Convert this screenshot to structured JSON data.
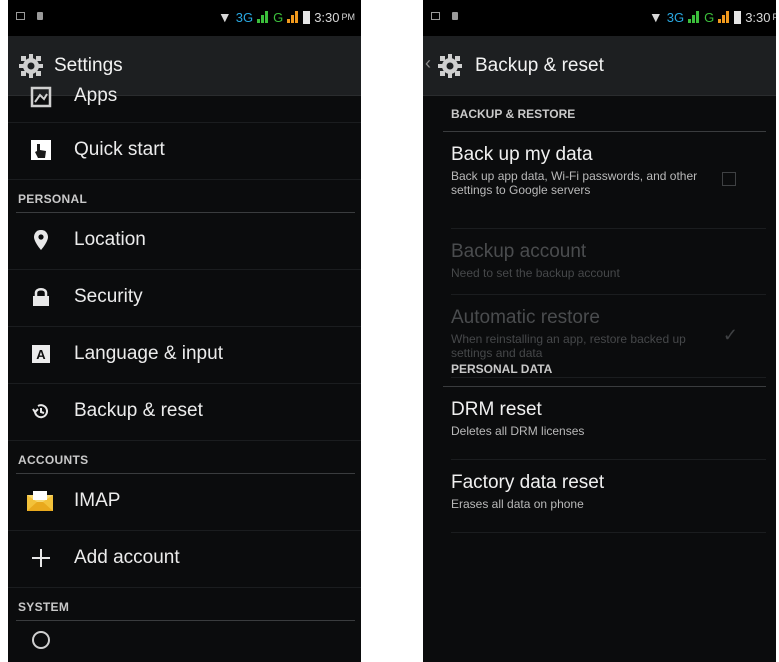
{
  "status_bar": {
    "net_3g": "3G",
    "net_g": "G",
    "time": "3:30",
    "ampm": "PM"
  },
  "left": {
    "title": "Settings",
    "items": [
      {
        "type": "item",
        "label": "Apps",
        "icon": "apps-icon"
      },
      {
        "type": "item",
        "label": "Quick start",
        "icon": "quick-start-icon"
      },
      {
        "type": "header",
        "label": "PERSONAL"
      },
      {
        "type": "item",
        "label": "Location",
        "icon": "location-pin-icon"
      },
      {
        "type": "item",
        "label": "Security",
        "icon": "lock-icon"
      },
      {
        "type": "item",
        "label": "Language & input",
        "icon": "keyboard-icon"
      },
      {
        "type": "item",
        "label": "Backup & reset",
        "icon": "backup-restore-icon"
      },
      {
        "type": "header",
        "label": "ACCOUNTS"
      },
      {
        "type": "item",
        "label": "IMAP",
        "icon": "email-icon"
      },
      {
        "type": "item",
        "label": "Add account",
        "icon": "plus-icon"
      },
      {
        "type": "header",
        "label": "SYSTEM"
      }
    ]
  },
  "right": {
    "title": "Backup & reset",
    "section1": "BACKUP & RESTORE",
    "backup_data": {
      "title": "Back up my data",
      "summary": "Back up app data, Wi-Fi passwords, and other settings to Google servers"
    },
    "backup_account": {
      "title": "Backup account",
      "summary": "Need to set the backup account"
    },
    "auto_restore": {
      "title": "Automatic restore",
      "summary": "When reinstalling an app, restore backed up settings and data"
    },
    "section2": "PERSONAL DATA",
    "drm_reset": {
      "title": "DRM reset",
      "summary": "Deletes all DRM licenses"
    },
    "factory_reset": {
      "title": "Factory data reset",
      "summary": "Erases all data on phone"
    }
  },
  "colors": {
    "accent_blue": "#29a7e0",
    "signal_green": "#3cbf3c",
    "signal_orange": "#f29a1d"
  }
}
